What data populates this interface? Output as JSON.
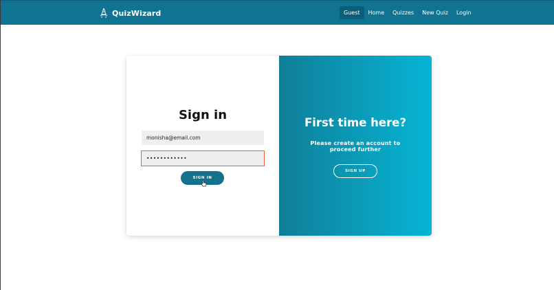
{
  "colors": {
    "navbar": "#0f7391",
    "active_nav": "#0c5e78",
    "primary_button": "#15728d",
    "gradient_start": "#0f7e98",
    "gradient_end": "#06b5d5",
    "focus_border": "#ea5c36"
  },
  "navbar": {
    "brand_icon": "wizard-hat-icon",
    "brand_name": "QuizWizard",
    "links": [
      {
        "label": "Guest",
        "active": true
      },
      {
        "label": "Home",
        "active": false
      },
      {
        "label": "Quizzes",
        "active": false
      },
      {
        "label": "New Quiz",
        "active": false
      },
      {
        "label": "Login",
        "active": false
      }
    ]
  },
  "signin": {
    "title": "Sign in",
    "email_value": "monisha@email.com",
    "password_value": "••••••••••••",
    "button_label": "SIGN IN"
  },
  "signup_panel": {
    "title": "First time here?",
    "subtitle": "Please create an account to proceed further",
    "button_label": "SIGN UP"
  }
}
